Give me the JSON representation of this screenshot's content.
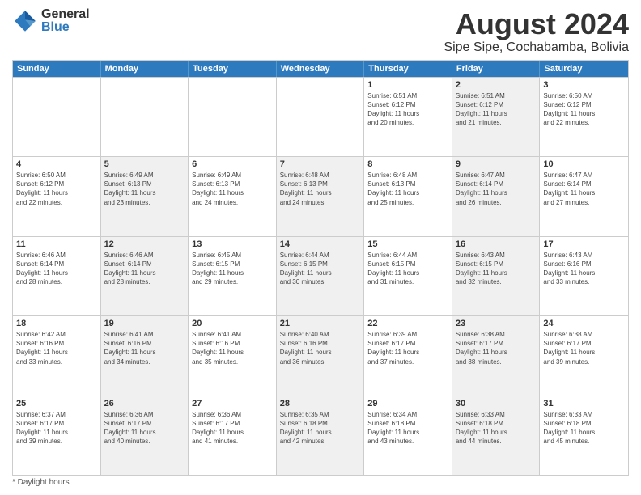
{
  "logo": {
    "general": "General",
    "blue": "Blue"
  },
  "title": {
    "month_year": "August 2024",
    "location": "Sipe Sipe, Cochabamba, Bolivia"
  },
  "calendar": {
    "headers": [
      "Sunday",
      "Monday",
      "Tuesday",
      "Wednesday",
      "Thursday",
      "Friday",
      "Saturday"
    ],
    "weeks": [
      [
        {
          "day": "",
          "info": "",
          "shaded": false
        },
        {
          "day": "",
          "info": "",
          "shaded": false
        },
        {
          "day": "",
          "info": "",
          "shaded": false
        },
        {
          "day": "",
          "info": "",
          "shaded": false
        },
        {
          "day": "1",
          "info": "Sunrise: 6:51 AM\nSunset: 6:12 PM\nDaylight: 11 hours\nand 20 minutes.",
          "shaded": false
        },
        {
          "day": "2",
          "info": "Sunrise: 6:51 AM\nSunset: 6:12 PM\nDaylight: 11 hours\nand 21 minutes.",
          "shaded": true
        },
        {
          "day": "3",
          "info": "Sunrise: 6:50 AM\nSunset: 6:12 PM\nDaylight: 11 hours\nand 22 minutes.",
          "shaded": false
        }
      ],
      [
        {
          "day": "4",
          "info": "Sunrise: 6:50 AM\nSunset: 6:12 PM\nDaylight: 11 hours\nand 22 minutes.",
          "shaded": false
        },
        {
          "day": "5",
          "info": "Sunrise: 6:49 AM\nSunset: 6:13 PM\nDaylight: 11 hours\nand 23 minutes.",
          "shaded": true
        },
        {
          "day": "6",
          "info": "Sunrise: 6:49 AM\nSunset: 6:13 PM\nDaylight: 11 hours\nand 24 minutes.",
          "shaded": false
        },
        {
          "day": "7",
          "info": "Sunrise: 6:48 AM\nSunset: 6:13 PM\nDaylight: 11 hours\nand 24 minutes.",
          "shaded": true
        },
        {
          "day": "8",
          "info": "Sunrise: 6:48 AM\nSunset: 6:13 PM\nDaylight: 11 hours\nand 25 minutes.",
          "shaded": false
        },
        {
          "day": "9",
          "info": "Sunrise: 6:47 AM\nSunset: 6:14 PM\nDaylight: 11 hours\nand 26 minutes.",
          "shaded": true
        },
        {
          "day": "10",
          "info": "Sunrise: 6:47 AM\nSunset: 6:14 PM\nDaylight: 11 hours\nand 27 minutes.",
          "shaded": false
        }
      ],
      [
        {
          "day": "11",
          "info": "Sunrise: 6:46 AM\nSunset: 6:14 PM\nDaylight: 11 hours\nand 28 minutes.",
          "shaded": false
        },
        {
          "day": "12",
          "info": "Sunrise: 6:46 AM\nSunset: 6:14 PM\nDaylight: 11 hours\nand 28 minutes.",
          "shaded": true
        },
        {
          "day": "13",
          "info": "Sunrise: 6:45 AM\nSunset: 6:15 PM\nDaylight: 11 hours\nand 29 minutes.",
          "shaded": false
        },
        {
          "day": "14",
          "info": "Sunrise: 6:44 AM\nSunset: 6:15 PM\nDaylight: 11 hours\nand 30 minutes.",
          "shaded": true
        },
        {
          "day": "15",
          "info": "Sunrise: 6:44 AM\nSunset: 6:15 PM\nDaylight: 11 hours\nand 31 minutes.",
          "shaded": false
        },
        {
          "day": "16",
          "info": "Sunrise: 6:43 AM\nSunset: 6:15 PM\nDaylight: 11 hours\nand 32 minutes.",
          "shaded": true
        },
        {
          "day": "17",
          "info": "Sunrise: 6:43 AM\nSunset: 6:16 PM\nDaylight: 11 hours\nand 33 minutes.",
          "shaded": false
        }
      ],
      [
        {
          "day": "18",
          "info": "Sunrise: 6:42 AM\nSunset: 6:16 PM\nDaylight: 11 hours\nand 33 minutes.",
          "shaded": false
        },
        {
          "day": "19",
          "info": "Sunrise: 6:41 AM\nSunset: 6:16 PM\nDaylight: 11 hours\nand 34 minutes.",
          "shaded": true
        },
        {
          "day": "20",
          "info": "Sunrise: 6:41 AM\nSunset: 6:16 PM\nDaylight: 11 hours\nand 35 minutes.",
          "shaded": false
        },
        {
          "day": "21",
          "info": "Sunrise: 6:40 AM\nSunset: 6:16 PM\nDaylight: 11 hours\nand 36 minutes.",
          "shaded": true
        },
        {
          "day": "22",
          "info": "Sunrise: 6:39 AM\nSunset: 6:17 PM\nDaylight: 11 hours\nand 37 minutes.",
          "shaded": false
        },
        {
          "day": "23",
          "info": "Sunrise: 6:38 AM\nSunset: 6:17 PM\nDaylight: 11 hours\nand 38 minutes.",
          "shaded": true
        },
        {
          "day": "24",
          "info": "Sunrise: 6:38 AM\nSunset: 6:17 PM\nDaylight: 11 hours\nand 39 minutes.",
          "shaded": false
        }
      ],
      [
        {
          "day": "25",
          "info": "Sunrise: 6:37 AM\nSunset: 6:17 PM\nDaylight: 11 hours\nand 39 minutes.",
          "shaded": false
        },
        {
          "day": "26",
          "info": "Sunrise: 6:36 AM\nSunset: 6:17 PM\nDaylight: 11 hours\nand 40 minutes.",
          "shaded": true
        },
        {
          "day": "27",
          "info": "Sunrise: 6:36 AM\nSunset: 6:17 PM\nDaylight: 11 hours\nand 41 minutes.",
          "shaded": false
        },
        {
          "day": "28",
          "info": "Sunrise: 6:35 AM\nSunset: 6:18 PM\nDaylight: 11 hours\nand 42 minutes.",
          "shaded": true
        },
        {
          "day": "29",
          "info": "Sunrise: 6:34 AM\nSunset: 6:18 PM\nDaylight: 11 hours\nand 43 minutes.",
          "shaded": false
        },
        {
          "day": "30",
          "info": "Sunrise: 6:33 AM\nSunset: 6:18 PM\nDaylight: 11 hours\nand 44 minutes.",
          "shaded": true
        },
        {
          "day": "31",
          "info": "Sunrise: 6:33 AM\nSunset: 6:18 PM\nDaylight: 11 hours\nand 45 minutes.",
          "shaded": false
        }
      ]
    ]
  },
  "footer": {
    "note": "Daylight hours"
  }
}
